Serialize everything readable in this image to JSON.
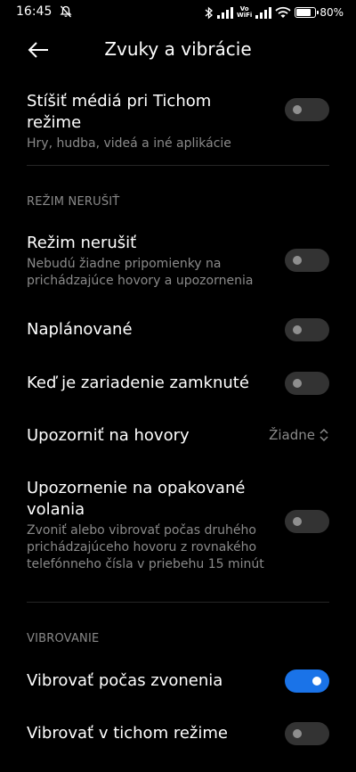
{
  "status_bar": {
    "time": "16:45",
    "vowifi_top": "Vo",
    "vowifi_bottom": "WiFi",
    "battery_text": "80%",
    "battery_level": 0.8,
    "icons": [
      "mute-icon",
      "bluetooth-icon",
      "signal-icon",
      "wifi-icon",
      "battery-icon"
    ]
  },
  "header": {
    "title": "Zvuky a vibrácie",
    "back_icon": "arrow-left-icon"
  },
  "rows": {
    "silent_media": {
      "title": "Stíšiť médiá pri Tichom režime",
      "subtitle": "Hry, hudba, videá a iné aplikácie",
      "on": false
    },
    "dnd": {
      "title": "Režim nerušiť",
      "subtitle": "Nebudú žiadne pripomienky na prichádzajúce hovory a upozornenia",
      "on": false
    },
    "scheduled": {
      "title": "Naplánované",
      "on": false
    },
    "locked": {
      "title": "Keď je zariadenie zamknuté",
      "on": false
    },
    "notify_calls": {
      "title": "Upozorniť na hovory",
      "value": "Žiadne"
    },
    "repeated_calls": {
      "title": "Upozornenie na opakované volania",
      "subtitle": "Zvoniť alebo vibrovať počas druhého prichádzajúceho hovoru z rovnakého telefónneho čísla v priebehu 15 minút",
      "on": false
    },
    "vibrate_ring": {
      "title": "Vibrovať počas zvonenia",
      "on": true
    },
    "vibrate_silent": {
      "title": "Vibrovať v tichom režime",
      "on": false
    }
  },
  "sections": {
    "dnd_label": "REŽIM NERUŠIŤ",
    "vibration_label": "VIBROVANIE"
  },
  "colors": {
    "background": "#000000",
    "accent": "#1a73e8",
    "secondary_text": "#8a8a8a",
    "toggle_off": "#333333"
  }
}
